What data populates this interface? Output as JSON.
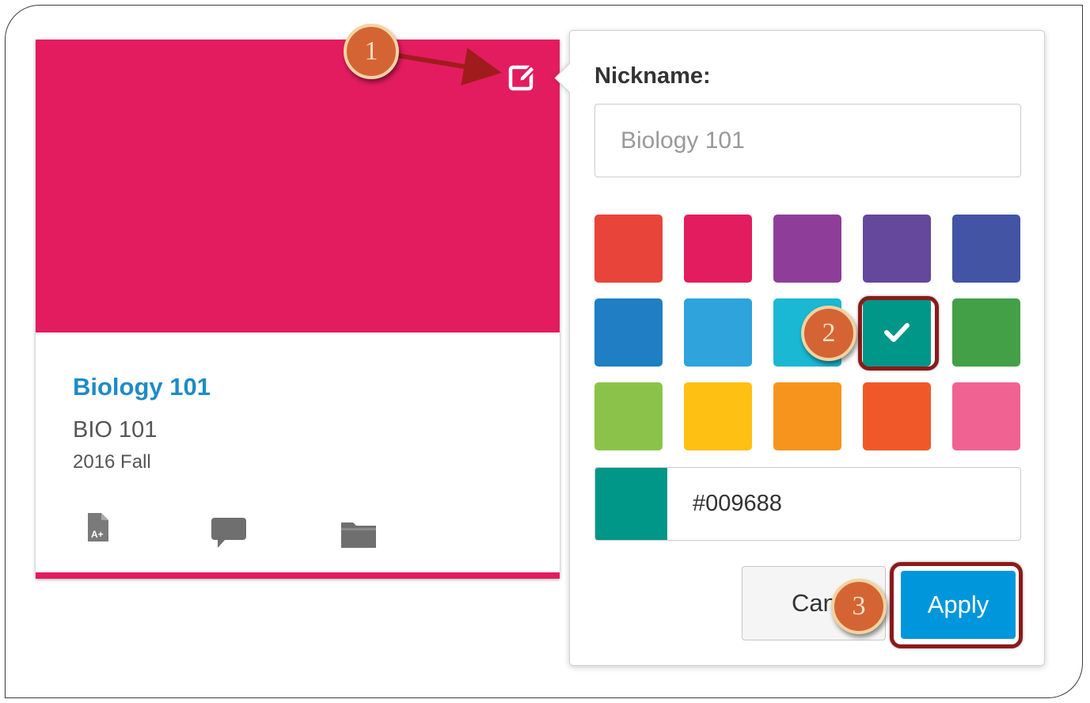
{
  "card": {
    "title": "Biology 101",
    "code": "BIO 101",
    "term": "2016 Fall",
    "color": "#e31c5f",
    "icons": [
      "grades-icon",
      "discussion-icon",
      "files-icon"
    ]
  },
  "popover": {
    "nickname_label": "Nickname:",
    "nickname_placeholder": "Biology 101",
    "swatches": [
      "#e8443a",
      "#e31c5f",
      "#8e3e99",
      "#65489b",
      "#4354a4",
      "#1f7ec4",
      "#2ea3dc",
      "#1ab8d2",
      "#009688",
      "#43a047",
      "#8bc34a",
      "#fec012",
      "#f7941d",
      "#f0582a",
      "#f06292"
    ],
    "selected_color": "#009688",
    "hex_value": "#009688",
    "cancel_label": "Cancel",
    "apply_label": "Apply",
    "apply_color": "#0096db"
  },
  "callouts": [
    "1",
    "2",
    "3"
  ]
}
